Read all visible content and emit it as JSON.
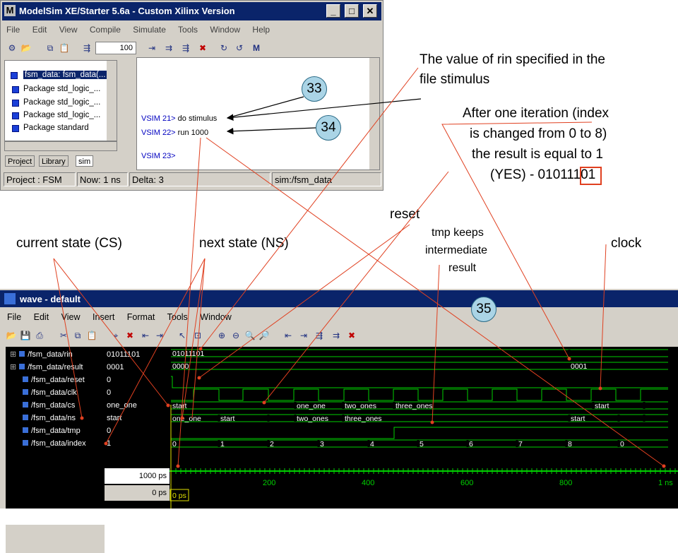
{
  "modelsim": {
    "title": "ModelSim XE/Starter 5.6a - Custom Xilinx Version",
    "app_icon": "M",
    "menu": [
      "File",
      "Edit",
      "View",
      "Compile",
      "Simulate",
      "Tools",
      "Window",
      "Help"
    ],
    "toolbar_value": "100",
    "tree": [
      "fsm_data: fsm_data(...",
      "Package std_logic_...",
      "Package std_logic_...",
      "Package std_logic_...",
      "Package standard"
    ],
    "tabs": [
      "Project",
      "Library",
      "sim"
    ],
    "console": [
      {
        "prompt": "VSIM 21>",
        "cmd": "do stimulus"
      },
      {
        "prompt": "VSIM 22>",
        "cmd": "run 1000"
      },
      {
        "prompt": "VSIM 23>",
        "cmd": ""
      }
    ],
    "status": {
      "project": "Project : FSM",
      "now": "Now: 1 ns",
      "delta": "Delta: 3",
      "sim": "sim:/fsm_data"
    }
  },
  "wave": {
    "title": "wave - default",
    "menu": [
      "File",
      "Edit",
      "View",
      "Insert",
      "Format",
      "Tools",
      "Window"
    ],
    "signals": [
      {
        "name": "/fsm_data/rin",
        "value": "01011101",
        "expand": true
      },
      {
        "name": "/fsm_data/result",
        "value": "0001",
        "expand": true
      },
      {
        "name": "/fsm_data/reset",
        "value": "0",
        "expand": false
      },
      {
        "name": "/fsm_data/clk",
        "value": "0",
        "expand": false
      },
      {
        "name": "/fsm_data/cs",
        "value": "one_one",
        "expand": false
      },
      {
        "name": "/fsm_data/ns",
        "value": "start",
        "expand": false
      },
      {
        "name": "/fsm_data/tmp",
        "value": "0",
        "expand": false
      },
      {
        "name": "/fsm_data/index",
        "value": "1",
        "expand": false
      }
    ],
    "cursor_value": "1000 ps",
    "cursor_origin": "0 ps",
    "cursor_label": "0 ps",
    "time_ticks": [
      "200",
      "400",
      "600",
      "800",
      "1 ns"
    ],
    "traces": {
      "rin_label": "01011101",
      "result_labels": [
        "0000",
        "0001"
      ],
      "cs_labels": [
        "start",
        "one_one",
        "two_ones",
        "three_ones",
        "start"
      ],
      "ns_labels": [
        "one_one",
        "start",
        "two_ones",
        "three_ones",
        "start"
      ],
      "index_labels": [
        "0",
        "1",
        "2",
        "3",
        "4",
        "5",
        "6",
        "7",
        "8",
        "0"
      ]
    }
  },
  "annotations": {
    "rin_note_1": "The value of rin specified in the",
    "rin_note_2": "file stimulus",
    "iter_1": "After one iteration (index",
    "iter_2": "is changed from 0 to 8)",
    "iter_3": "the result is equal to 1",
    "iter_4": "(YES) - 01011101",
    "reset": "reset",
    "tmp_1": "tmp keeps",
    "tmp_2": "intermediate",
    "tmp_3": "result",
    "cs": "current state (CS)",
    "ns": "next state (NS)",
    "clock": "clock",
    "b33": "33",
    "b34": "34",
    "b35": "35"
  }
}
